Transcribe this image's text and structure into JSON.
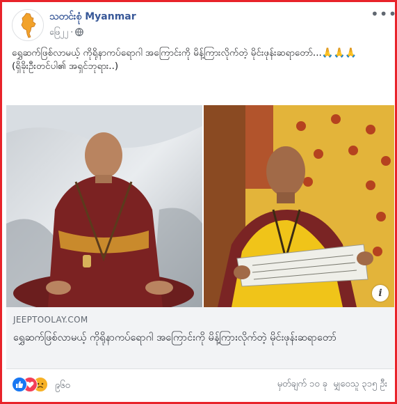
{
  "post": {
    "page_name": "သတင်းစုံ Myanmar",
    "timestamp": "ဖြေ၂၂",
    "privacy_icon": "globe-icon",
    "more_icon": "more-options-icon",
    "text_line1": "ရွှေဆက်ဖြစ်လာမယ့် ကိုရိုနာကပ်ရောဂါ အကြောင်းကို မိန့်ကြားလိုက်တဲ့ မိုင်းဖုန်းဆရာတော်...🙏🙏🙏",
    "text_line2": "(ရှိခိုးဦးတင်ပါ၏ အရှင်ဘုရား..)"
  },
  "link_preview": {
    "domain": "JEEPTOOLAY.COM",
    "title": "ရွှေဆက်ဖြစ်လာမယ့် ကိုရိုနာကပ်ရောဂါ အကြောင်းကို မိန့်ကြားလိုက်တဲ့ မိုင်းဖုန်းဆရာတော်",
    "info_label": "i"
  },
  "engagement": {
    "reaction_icons": [
      "like-icon",
      "love-icon",
      "sad-icon"
    ],
    "reaction_count": "၉၆၀",
    "comments": "မှတ်ချက် ၁၀ ခု",
    "shares": "မျှဝေသူ ၃၁၅ ဦး",
    "colors": {
      "like": "#1877f2",
      "love": "#f33e58",
      "sad": "#f7b125"
    }
  },
  "colors": {
    "frame_border": "#e8232a",
    "page_name": "#385898",
    "link_card_bg": "#f2f3f5"
  }
}
